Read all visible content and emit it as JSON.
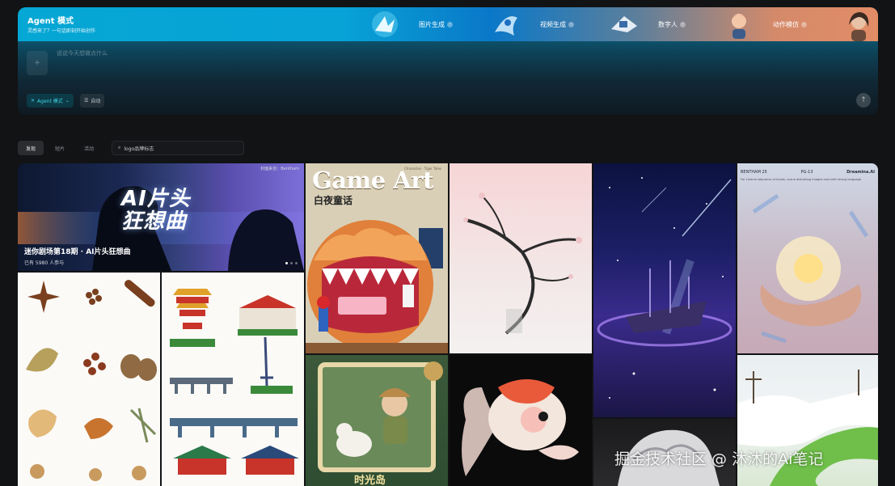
{
  "agent": {
    "title": "Agent 模式",
    "subtitle": "灵感来了？一句话即刻开始创作",
    "features": [
      {
        "label": "图片生成"
      },
      {
        "label": "视频生成"
      },
      {
        "label": "数字人"
      },
      {
        "label": "动作模仿"
      }
    ],
    "prompt_placeholder": "说说今天想做点什么",
    "upload_label": "+",
    "mode_label": "Agent 模式",
    "auto_label": "自动",
    "send_icon": "arrow-up-icon"
  },
  "tabs": [
    {
      "label": "发现",
      "active": true
    },
    {
      "label": "短片",
      "active": false
    },
    {
      "label": "活动",
      "active": false
    }
  ],
  "search": {
    "value": "logo品牌标志"
  },
  "banner": {
    "title_line1": "AI片头",
    "title_line2": "狂想曲",
    "caption": "迷你剧场第18期 · AI片头狂想曲",
    "participants": "已有 5980 人参与",
    "credit": "封面来自：Bentham"
  },
  "game_art": {
    "title": "Game Art",
    "subtitle": "白夜童话",
    "top_text": "Chronicles · Tiger Tales"
  },
  "adventure": {
    "title": "时光岛"
  },
  "hands": {
    "tag_left": "BENTHAM 25",
    "tag_mid": "PG-13",
    "tag_right": "Dreamina.AI",
    "desc": "For cinema sequence of hands, scene disturbing images and brief strong language"
  },
  "watermark": "掘金技术社区 @ 沐沐的Ai笔记",
  "colors": {
    "accent": "#05a7d4",
    "mode_accent": "#3fd4e4",
    "background": "#121315"
  }
}
